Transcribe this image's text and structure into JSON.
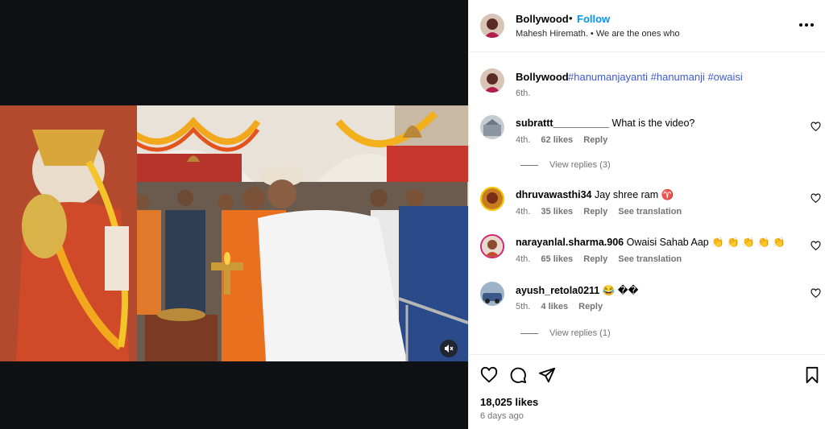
{
  "post": {
    "username": "Bollywood",
    "dot": "•",
    "follow_label": "Follow",
    "audio_line": "Mahesh Hiremath. • We are the ones who"
  },
  "caption": {
    "username": "Bollywood",
    "hashtags": "#hanumanjayanti #hanumanji #owaisi",
    "time": "6th."
  },
  "comments": [
    {
      "username": "subrattt__________",
      "text": "What is the video?",
      "time": "4th.",
      "likes": "62 likes",
      "reply": "Reply",
      "translate": "",
      "view_replies": "View replies (3)"
    },
    {
      "username": "dhruvawasthi34",
      "text": "Jay shree ram ♈",
      "time": "4th.",
      "likes": "35 likes",
      "reply": "Reply",
      "translate": "See translation",
      "view_replies": ""
    },
    {
      "username": "narayanlal.sharma.906",
      "text": "Owaisi Sahab Aap 👏 👏 👏 👏 👏",
      "time": "4th.",
      "likes": "65 likes",
      "reply": "Reply",
      "translate": "See translation",
      "view_replies": ""
    },
    {
      "username": "ayush_retola0211",
      "text": "😂 ��",
      "time": "5th.",
      "likes": "4 likes",
      "reply": "Reply",
      "translate": "",
      "view_replies": "View replies (1)"
    }
  ],
  "footer": {
    "likes": "18,025 likes",
    "date": "6 days ago"
  },
  "icons": {
    "heart": "heart-icon",
    "comment": "comment-icon",
    "share": "share-icon",
    "save": "bookmark-icon",
    "mute": "speaker-muted-icon",
    "more": "more-horizontal-icon"
  },
  "colors": {
    "link_blue": "#0095f6",
    "hashtag_blue": "#3f5bd1",
    "muted_text": "#737373"
  }
}
